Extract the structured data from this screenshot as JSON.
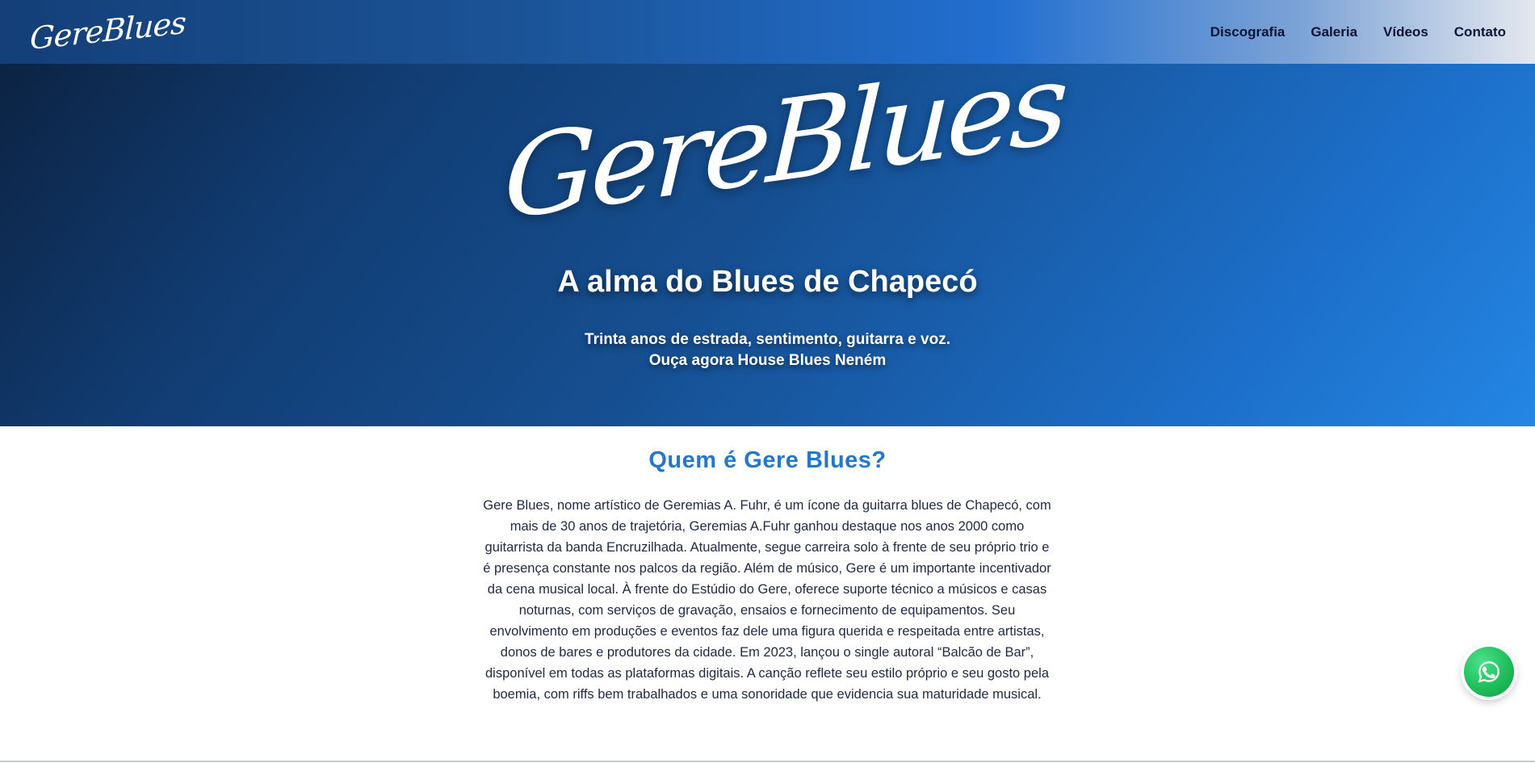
{
  "header": {
    "logo_text": "GereBlues",
    "nav": [
      {
        "label": "Discografia"
      },
      {
        "label": "Galeria"
      },
      {
        "label": "Vídeos"
      },
      {
        "label": "Contato"
      }
    ]
  },
  "hero": {
    "logo_text": "GereBlues",
    "title": "A alma do Blues de Chapecó",
    "subtitle_line1": "Trinta anos de estrada, sentimento, guitarra e voz.",
    "subtitle_line2": "Ouça agora House Blues Neném"
  },
  "about": {
    "heading": "Quem é Gere Blues?",
    "body": "Gere Blues, nome artístico de Geremias A. Fuhr, é um ícone da guitarra blues de Chapecó, com mais de 30 anos de trajetória, Geremias A.Fuhr ganhou destaque nos anos 2000 como guitarrista da banda Encruzilhada. Atualmente, segue carreira solo à frente de seu próprio trio e é presença constante nos palcos da região. Além de músico, Gere é um importante incentivador da cena musical local. À frente do Estúdio do Gere, oferece suporte técnico a músicos e casas noturnas, com serviços de gravação, ensaios e fornecimento de equipamentos. Seu envolvimento em produções e eventos faz dele uma figura querida e respeitada entre artistas, donos de bares e produtores da cidade. Em 2023, lançou o single autoral “Balcão de Bar”, disponível em todas as plataformas digitais. A canção reflete seu estilo próprio e seu gosto pela boemia, com riffs bem trabalhados e uma sonoridade que evidencia sua maturidade musical."
  },
  "floating": {
    "icon": "whatsapp-icon"
  },
  "colors": {
    "accent": "#2478cc",
    "whatsapp": "#1fbf5b",
    "nav_text": "#0b1533"
  }
}
